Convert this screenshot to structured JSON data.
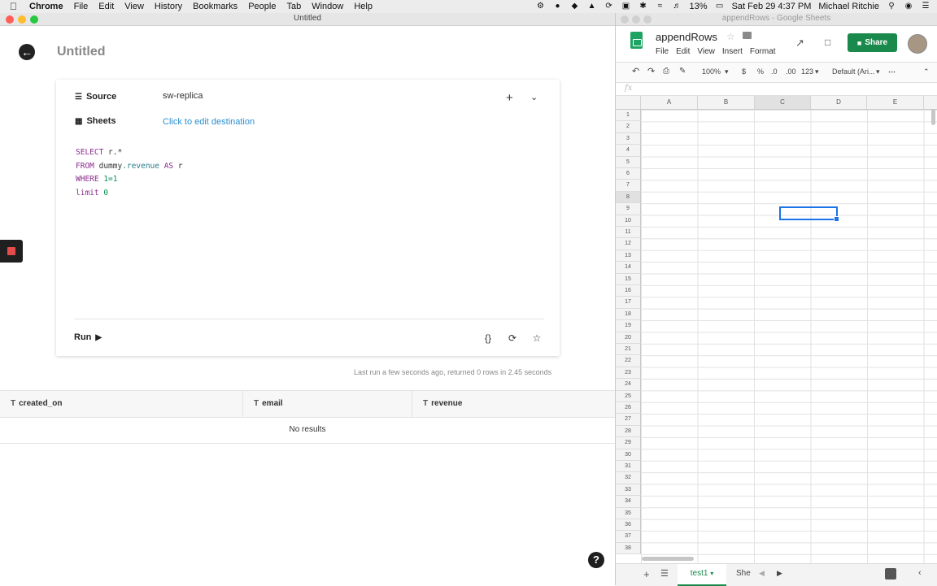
{
  "menubar": {
    "items": [
      "Chrome",
      "File",
      "Edit",
      "View",
      "History",
      "Bookmarks",
      "People",
      "Tab",
      "Window",
      "Help"
    ],
    "battery": "13%",
    "datetime": "Sat Feb 29  4:37 PM",
    "user": "Michael Ritchie"
  },
  "left_window": {
    "window_title": "Untitled",
    "page_title": "Untitled",
    "source_label": "Source",
    "source_value": "sw-replica",
    "sheets_label": "Sheets",
    "sheets_value": "Click to edit destination",
    "sql": {
      "l1_kw": "SELECT",
      "l1_rest": " r.*",
      "l2_kw": "FROM",
      "l2_a": " dummy",
      "l2_b": ".revenue",
      "l2_kw2": " AS",
      "l2_c": " r",
      "l3_kw": "WHERE",
      "l3_num": " 1=1",
      "l4_kw": "limit",
      "l4_num": " 0"
    },
    "run_label": "Run",
    "last_run": "Last run a few seconds ago, returned 0 rows in 2.45 seconds",
    "columns": [
      "created_on",
      "email",
      "revenue"
    ],
    "empty_text": "No results"
  },
  "right_window": {
    "window_title": "appendRows - Google Sheets",
    "doc_title": "appendRows",
    "menu": [
      "File",
      "Edit",
      "View",
      "Insert",
      "Format"
    ],
    "share_label": "Share",
    "zoom": "100%",
    "currency": "$",
    "percent": "%",
    "dec_less": ".0",
    "dec_more": ".00",
    "num_format": "123",
    "font": "Default (Ari...",
    "columns": [
      "A",
      "B",
      "C",
      "D",
      "E"
    ],
    "rows": [
      "1",
      "2",
      "3",
      "4",
      "5",
      "6",
      "7",
      "8",
      "9",
      "10",
      "11",
      "12",
      "13",
      "14",
      "15",
      "16",
      "17",
      "18",
      "19",
      "20",
      "21",
      "22",
      "23",
      "24",
      "25",
      "26",
      "27",
      "28",
      "29",
      "30",
      "31",
      "32",
      "33",
      "34",
      "35",
      "36",
      "37",
      "38"
    ],
    "selected_cell": "C8",
    "active_tab": "test1",
    "other_tab": "She"
  }
}
